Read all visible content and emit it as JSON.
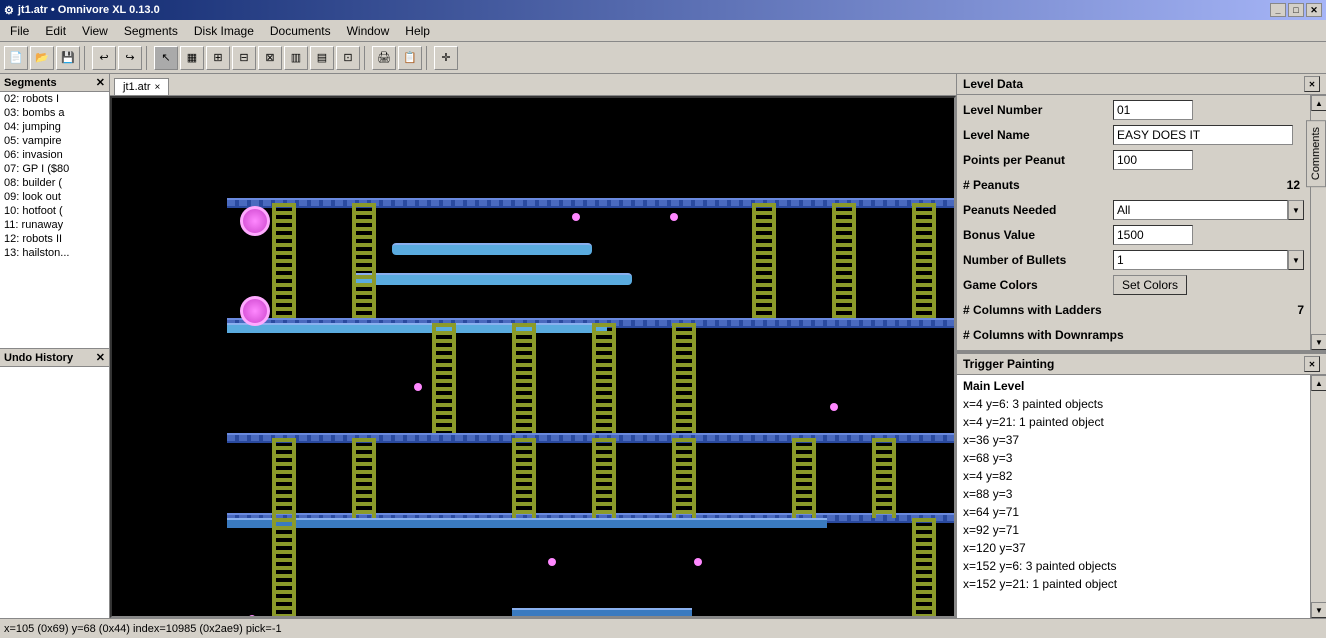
{
  "titlebar": {
    "title": "jt1.atr • Omnivore XL 0.13.0",
    "icon": "app-icon",
    "buttons": [
      "minimize",
      "maximize",
      "close"
    ]
  },
  "menubar": {
    "items": [
      "File",
      "Edit",
      "View",
      "Segments",
      "Disk Image",
      "Documents",
      "Window",
      "Help"
    ]
  },
  "toolbar": {
    "buttons": [
      "new",
      "open",
      "save",
      "sep",
      "undo",
      "redo",
      "sep",
      "cut",
      "copy",
      "paste",
      "sep",
      "zoom-in",
      "zoom-out",
      "sep",
      "grid",
      "snap",
      "sep",
      "pointer",
      "sep",
      "move"
    ]
  },
  "segments": {
    "header": "Segments",
    "items": [
      "02: robots I",
      "03: bombs a",
      "04: jumping",
      "05: vampire",
      "06: invasion",
      "07: GP I ($80",
      "08: builder (",
      "09: look out",
      "10: hotfoot (",
      "11: runaway",
      "12: robots II",
      "13: hailston..."
    ]
  },
  "undo": {
    "header": "Undo History"
  },
  "canvas_tab": {
    "label": "jt1.atr",
    "close": "×"
  },
  "level_data": {
    "header": "Level Data",
    "fields": {
      "level_number_label": "Level Number",
      "level_number_value": "01",
      "level_name_label": "Level Name",
      "level_name_value": "EASY DOES IT",
      "points_per_peanut_label": "Points per Peanut",
      "points_per_peanut_value": "100",
      "peanuts_label": "# Peanuts",
      "peanuts_value": "12",
      "peanuts_needed_label": "Peanuts Needed",
      "peanuts_needed_value": "All",
      "bonus_value_label": "Bonus Value",
      "bonus_value_value": "1500",
      "number_of_bullets_label": "Number of Bullets",
      "number_of_bullets_value": "1",
      "game_colors_label": "Game Colors",
      "game_colors_btn": "Set Colors",
      "columns_ladders_label": "# Columns with Ladders",
      "columns_ladders_value": "7",
      "columns_downramps_label": "# Columns with Downramps"
    }
  },
  "trigger_painting": {
    "header": "Trigger Painting",
    "items": [
      {
        "type": "header",
        "text": "Main Level"
      },
      {
        "type": "entry",
        "text": "x=4 y=6: 3 painted objects"
      },
      {
        "type": "entry",
        "text": "x=4 y=21: 1 painted object"
      },
      {
        "type": "entry",
        "text": "x=36 y=37"
      },
      {
        "type": "entry",
        "text": "x=68 y=3"
      },
      {
        "type": "entry",
        "text": "x=4 y=82"
      },
      {
        "type": "entry",
        "text": "x=88 y=3"
      },
      {
        "type": "entry",
        "text": "x=64 y=71"
      },
      {
        "type": "entry",
        "text": "x=92 y=71"
      },
      {
        "type": "entry",
        "text": "x=120 y=37"
      },
      {
        "type": "entry",
        "text": "x=152 y=6: 3 painted objects"
      },
      {
        "type": "entry",
        "text": "x=152 y=21: 1 painted object"
      }
    ]
  },
  "statusbar": {
    "text": "x=105 (0x69) y=68 (0x44) index=10985 (0x2ae9) pick=-1"
  },
  "comments_tab": {
    "label": "Comments"
  }
}
